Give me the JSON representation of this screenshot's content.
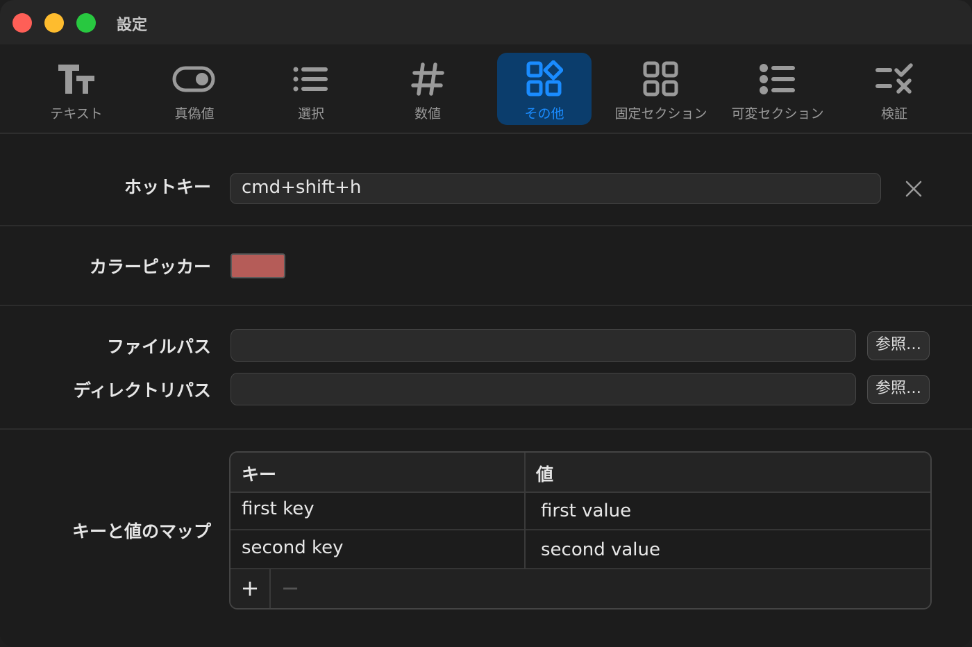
{
  "window": {
    "title": "設定"
  },
  "toolbar": {
    "tabs": [
      {
        "label": "テキスト",
        "icon": "text-size-icon"
      },
      {
        "label": "真偽値",
        "icon": "toggle-icon"
      },
      {
        "label": "選択",
        "icon": "list-icon"
      },
      {
        "label": "数値",
        "icon": "number-sign-icon"
      },
      {
        "label": "その他",
        "icon": "shapes-grid-icon",
        "active": true
      },
      {
        "label": "固定セクション",
        "icon": "grid-2x2-icon"
      },
      {
        "label": "可変セクション",
        "icon": "bullet-list-icon"
      },
      {
        "label": "検証",
        "icon": "checklist-icon"
      }
    ]
  },
  "hotkey": {
    "label": "ホットキー",
    "value": "cmd+shift+h"
  },
  "color_picker": {
    "label": "カラーピッカー",
    "color": "#b55c58"
  },
  "file_path": {
    "label": "ファイルパス",
    "value": "",
    "browse_label": "参照…"
  },
  "directory_path": {
    "label": "ディレクトリパス",
    "value": "",
    "browse_label": "参照…"
  },
  "key_value_map": {
    "label": "キーと値のマップ",
    "columns": [
      "キー",
      "値"
    ],
    "rows": [
      {
        "key": "first key",
        "value": "first value"
      },
      {
        "key": "second key",
        "value": "second value"
      }
    ],
    "add_label": "+",
    "remove_label": "−"
  },
  "colors": {
    "accent": "#1a8cff",
    "active_tab_bg": "#0b3d6c",
    "background": "#1c1c1c"
  }
}
